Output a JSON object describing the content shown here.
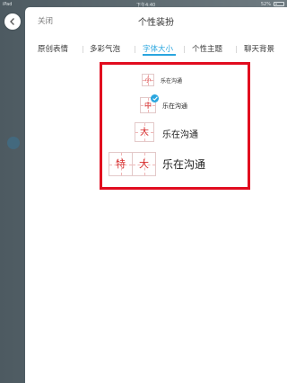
{
  "status_bar": {
    "carrier": "iPad",
    "time": "下午4:40",
    "battery": "52%"
  },
  "nav": {
    "close_label": "关闭",
    "title": "个性装扮"
  },
  "tabs": [
    {
      "label": "原创表情"
    },
    {
      "label": "多彩气泡"
    },
    {
      "label": "字体大小",
      "active": true
    },
    {
      "label": "个性主题"
    },
    {
      "label": "聊天背景"
    }
  ],
  "font_options": [
    {
      "glyphs": [
        "小"
      ],
      "label": "乐在沟通",
      "selected": false
    },
    {
      "glyphs": [
        "中"
      ],
      "label": "乐在沟通",
      "selected": true
    },
    {
      "glyphs": [
        "大"
      ],
      "label": "乐在沟通",
      "selected": false
    },
    {
      "glyphs": [
        "特",
        "大"
      ],
      "label": "乐在沟通",
      "selected": false
    }
  ],
  "colors": {
    "accent": "#2aa6df",
    "highlight_border": "#e10c1f",
    "glyph_red": "#d62a2a"
  },
  "icons": {
    "back": "chevron-left-icon",
    "selected": "checkmark-icon"
  }
}
